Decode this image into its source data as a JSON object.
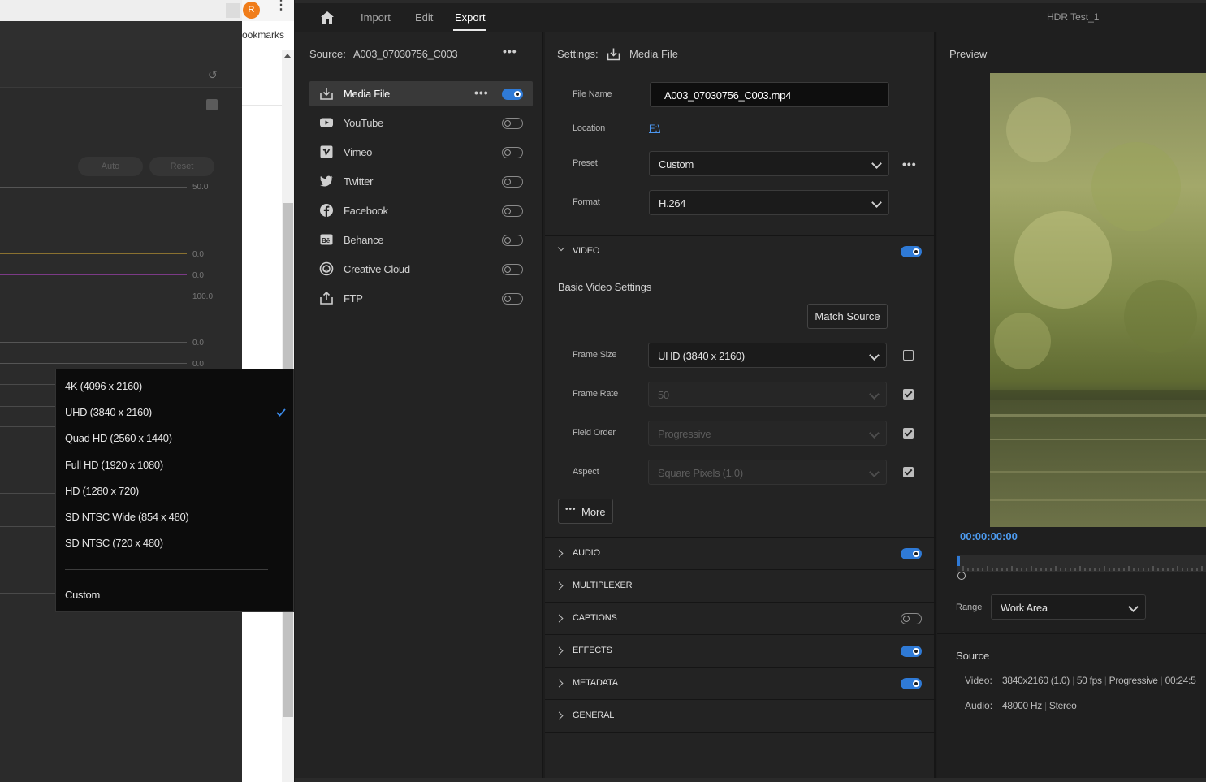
{
  "browser": {
    "avatar_letter": "R",
    "bookmarks_text": "ookmarks"
  },
  "left_panel": {
    "auto_label": "Auto",
    "reset_label": "Reset",
    "slider_values": [
      "50.0",
      "0.0",
      "0.0",
      "100.0",
      "0.0",
      "0.0"
    ]
  },
  "framesize_menu": {
    "items": [
      "4K (4096 x 2160)",
      "UHD (3840 x 2160)",
      "Quad HD (2560 x 1440)",
      "Full HD (1920 x 1080)",
      "HD (1280 x 720)",
      "SD NTSC Wide (854 x 480)",
      "SD NTSC (720 x 480)"
    ],
    "custom_label": "Custom",
    "selected": "UHD (3840 x 2160)"
  },
  "topbar": {
    "nav": [
      "Import",
      "Edit",
      "Export"
    ],
    "active": "Export",
    "project_title": "HDR Test_1"
  },
  "source": {
    "label": "Source:",
    "name": "A003_07030756_C003"
  },
  "destinations": [
    {
      "label": "Media File",
      "icon": "export-icon",
      "enabled": true
    },
    {
      "label": "YouTube",
      "icon": "youtube-icon",
      "enabled": false
    },
    {
      "label": "Vimeo",
      "icon": "vimeo-icon",
      "enabled": false
    },
    {
      "label": "Twitter",
      "icon": "twitter-icon",
      "enabled": false
    },
    {
      "label": "Facebook",
      "icon": "facebook-icon",
      "enabled": false
    },
    {
      "label": "Behance",
      "icon": "behance-icon",
      "enabled": false
    },
    {
      "label": "Creative Cloud",
      "icon": "creative-cloud-icon",
      "enabled": false
    },
    {
      "label": "FTP",
      "icon": "upload-icon",
      "enabled": false
    }
  ],
  "settings": {
    "label": "Settings:",
    "destination": "Media File",
    "file_name_label": "File Name",
    "file_name": "A003_07030756_C003.mp4",
    "location_label": "Location",
    "location": "F:\\",
    "preset_label": "Preset",
    "preset": "Custom",
    "format_label": "Format",
    "format": "H.264"
  },
  "video": {
    "section_title": "VIDEO",
    "enabled": true,
    "basic_title": "Basic Video Settings",
    "match_source": "Match Source",
    "frame_size_label": "Frame Size",
    "frame_size": "UHD (3840 x 2160)",
    "frame_rate_label": "Frame Rate",
    "frame_rate": "50",
    "field_order_label": "Field Order",
    "field_order": "Progressive",
    "aspect_label": "Aspect",
    "aspect": "Square Pixels (1.0)",
    "more_label": "More"
  },
  "sections": [
    {
      "title": "AUDIO",
      "toggle": "on"
    },
    {
      "title": "MULTIPLEXER",
      "toggle": "none"
    },
    {
      "title": "CAPTIONS",
      "toggle": "off"
    },
    {
      "title": "EFFECTS",
      "toggle": "on"
    },
    {
      "title": "METADATA",
      "toggle": "on"
    },
    {
      "title": "GENERAL",
      "toggle": "none"
    }
  ],
  "preview": {
    "title": "Preview",
    "timecode": "00:00:00:00",
    "range_label": "Range",
    "range_value": "Work Area",
    "source_title": "Source",
    "video_label": "Video:",
    "video_info": [
      "3840x2160 (1.0)",
      "50 fps",
      "Progressive",
      "00:24:5"
    ],
    "audio_label": "Audio:",
    "audio_info": [
      "48000 Hz",
      "Stereo"
    ]
  },
  "colors": {
    "accent": "#2f7ad6",
    "timecode": "#4d9bf0",
    "background": "#232323"
  }
}
